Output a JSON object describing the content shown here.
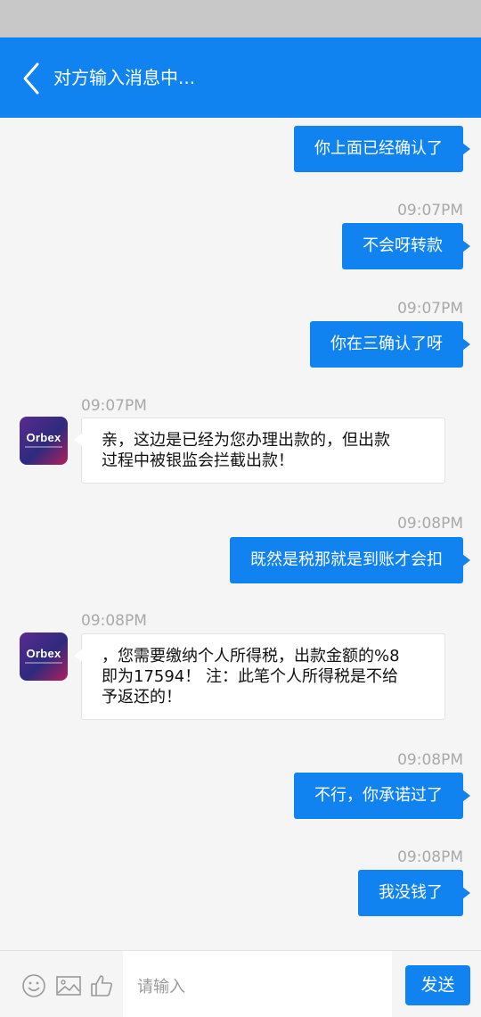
{
  "header": {
    "title": "对方输入消息中..."
  },
  "messages": [
    {
      "side": "out",
      "time": "",
      "text": "你上面已经确认了"
    },
    {
      "side": "out",
      "time": "09:07PM",
      "text": "不会呀转款"
    },
    {
      "side": "out",
      "time": "09:07PM",
      "text": "你在三确认了呀"
    },
    {
      "side": "in",
      "time": "09:07PM",
      "lines": [
        "亲，这边是已经为您办理出款的，但出款",
        "过程中被银监会拦截出款！"
      ],
      "avatar": "Orbex"
    },
    {
      "side": "out",
      "time": "09:08PM",
      "text": "既然是税那就是到账才会扣"
    },
    {
      "side": "in",
      "time": "09:08PM",
      "lines": [
        "，您需要缴纳个人所得税，出款金额的%8",
        "即为17594！ 注：此笔个人所得税是不给",
        "予返还的！"
      ],
      "avatar": "Orbex"
    },
    {
      "side": "out",
      "time": "09:08PM",
      "text": "不行，你承诺过了"
    },
    {
      "side": "out",
      "time": "09:08PM",
      "text": "我没钱了"
    }
  ],
  "input": {
    "placeholder": "请输入",
    "send_label": "发送"
  },
  "icons": {
    "back": "back-chevron-icon",
    "emoji": "emoji-icon",
    "image": "image-icon",
    "like": "thumbs-up-icon"
  },
  "colors": {
    "accent": "#1083f0",
    "background": "#f5f5f5"
  }
}
